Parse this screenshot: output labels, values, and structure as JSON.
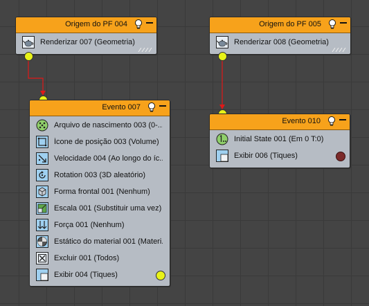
{
  "nodes": {
    "pf004": {
      "title": "Origem do PF 004",
      "items": [
        {
          "label": "Renderizar 007 (Geometria)",
          "icon": "teapot-icon"
        }
      ]
    },
    "pf005": {
      "title": "Origem do PF 005",
      "items": [
        {
          "label": "Renderizar 008 (Geometria)",
          "icon": "teapot-icon"
        }
      ]
    },
    "ev007": {
      "title": "Evento 007",
      "items": [
        {
          "label": "Arquivo de nascimento 003 (0-...",
          "icon": "birth-file-icon"
        },
        {
          "label": "Ícone de posição 003 (Volume)",
          "icon": "position-icon"
        },
        {
          "label": "Velocidade 004 (Ao longo do íc...",
          "icon": "speed-icon"
        },
        {
          "label": "Rotation 003 (3D aleatório)",
          "icon": "rotation-icon"
        },
        {
          "label": "Forma frontal 001 (Nenhum)",
          "icon": "shape-facing-icon"
        },
        {
          "label": "Escala 001 (Substituir uma vez)",
          "icon": "scale-icon"
        },
        {
          "label": "Força 001 (Nenhum)",
          "icon": "force-icon"
        },
        {
          "label": "Estático do material 001 (Materi...",
          "icon": "material-static-icon"
        },
        {
          "label": "Excluir 001 (Todos)",
          "icon": "delete-icon"
        },
        {
          "label": "Exibir 004 (Tiques)",
          "icon": "display-icon"
        }
      ]
    },
    "ev010": {
      "title": "Evento 010",
      "items": [
        {
          "label": "Initial State 001 (Em 0 T:0)",
          "icon": "initial-state-icon"
        },
        {
          "label": "Exibir 006 (Tiques)",
          "icon": "display-icon"
        }
      ]
    }
  },
  "colors": {
    "header": "#f7a21b",
    "body": "#b6bcc4",
    "socket": "#e8f218",
    "wire": "#e01818",
    "display_dot_ev010": "#7b2a2a",
    "background": "#444444"
  }
}
